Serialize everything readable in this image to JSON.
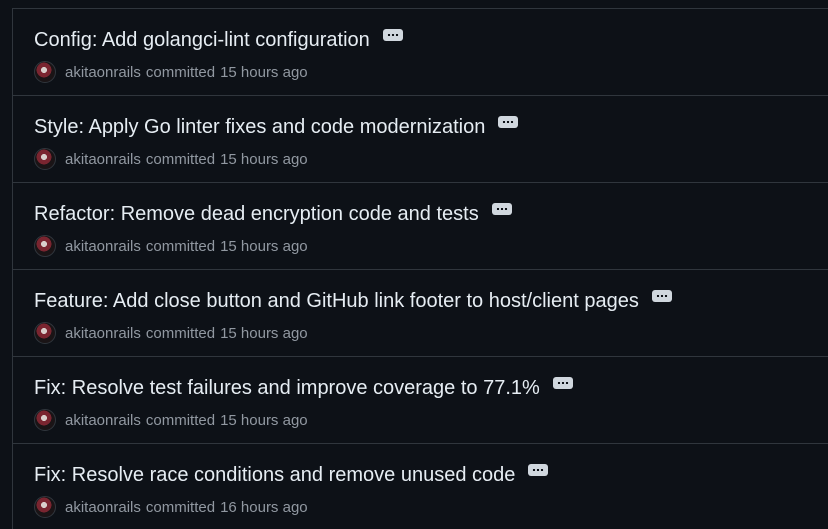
{
  "commits": [
    {
      "title": "Config: Add golangci-lint configuration",
      "author": "akitaonrails",
      "verb": "committed",
      "time": "15 hours ago"
    },
    {
      "title": "Style: Apply Go linter fixes and code modernization",
      "author": "akitaonrails",
      "verb": "committed",
      "time": "15 hours ago"
    },
    {
      "title": "Refactor: Remove dead encryption code and tests",
      "author": "akitaonrails",
      "verb": "committed",
      "time": "15 hours ago"
    },
    {
      "title": "Feature: Add close button and GitHub link footer to host/client pages",
      "author": "akitaonrails",
      "verb": "committed",
      "time": "15 hours ago"
    },
    {
      "title": "Fix: Resolve test failures and improve coverage to 77.1%",
      "author": "akitaonrails",
      "verb": "committed",
      "time": "15 hours ago"
    },
    {
      "title": "Fix: Resolve race conditions and remove unused code",
      "author": "akitaonrails",
      "verb": "committed",
      "time": "16 hours ago"
    }
  ],
  "icons": {
    "expand": "ellipsis-icon",
    "avatar": "user-avatar"
  }
}
